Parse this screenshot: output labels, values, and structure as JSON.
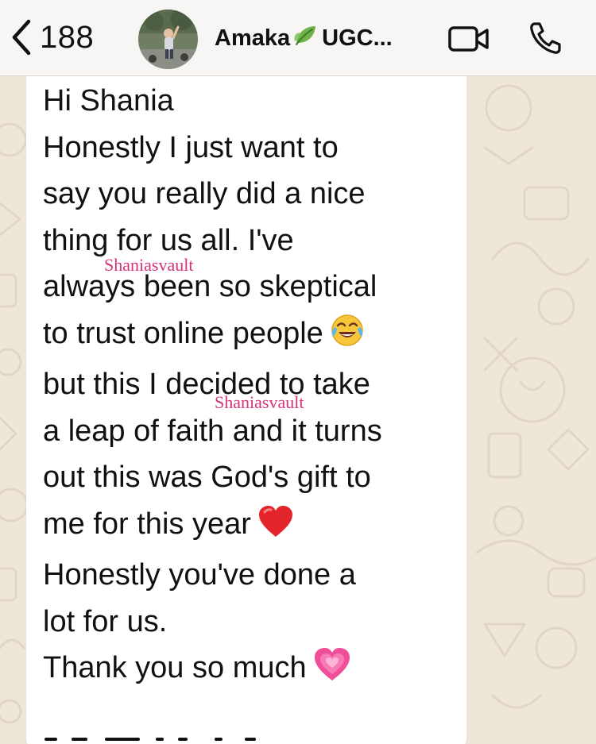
{
  "header": {
    "back_count": "188",
    "contact_name": "Amaka",
    "contact_suffix": "UGC...",
    "icons": {
      "back": "chevron-left-icon",
      "leaf": "leaf-emoji",
      "video": "video-camera-icon",
      "call": "phone-icon"
    }
  },
  "message": {
    "lines": [
      "Hi Shania",
      "Honestly I just want to",
      "say you really did a nice",
      "thing for us all. I've",
      "always been so skeptical",
      "to trust online people",
      "but this I decided to take",
      "a leap of faith and it turns",
      "out this was God's gift to",
      "me for this year",
      "Honestly you've done a",
      "lot for us.",
      "Thank you so much",
      ""
    ],
    "emojis": {
      "line6": "face-with-tears-of-joy-emoji",
      "line10": "red-heart-emoji",
      "line13": "growing-heart-emoji"
    }
  },
  "watermarks": [
    "Shaniasvault",
    "Shaniasvault"
  ],
  "colors": {
    "header_bg": "#f7f6f4",
    "wallpaper_bg": "#efe6da",
    "bubble_bg": "#ffffff",
    "watermark": "#d8327a"
  }
}
